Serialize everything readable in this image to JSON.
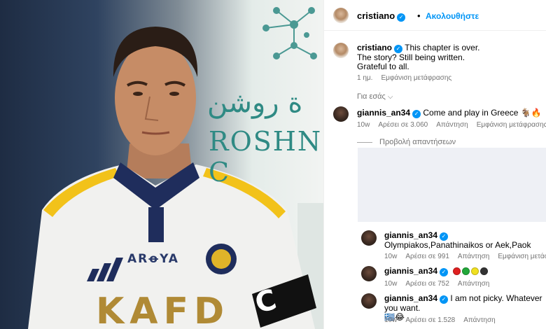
{
  "post": {
    "sign_arabic": "ة روشن",
    "sign_latin": "ROSHN C",
    "jersey_brand": "ARꝋYA",
    "jersey_sponsor": "KAFD",
    "armband_text": "C"
  },
  "header": {
    "username": "cristiano",
    "separator": "•",
    "follow_label": "Ακολουθήστε"
  },
  "caption": {
    "username": "cristiano",
    "line1": "This chapter is over.",
    "line2": "The story? Still being written.",
    "line3": "Grateful to all.",
    "time": "1 ημ.",
    "translate": "Εμφάνιση μετάφρασης"
  },
  "for_you": {
    "label": "Για εσάς",
    "icon": "chevron-down-icon"
  },
  "comments": [
    {
      "username": "giannis_an34",
      "text": "Come and play in Greece 🐐🔥",
      "time": "10w",
      "likes": "Αρέσει σε 3.060",
      "reply": "Απάντηση",
      "translate": "Εμφάνιση μετάφρασης"
    }
  ],
  "replies_toggle": "Προβολή απαντήσεων",
  "replies": [
    {
      "username": "giannis_an34",
      "text": "Olympiakos,Panathinaikos or Aek,Paok",
      "time": "10w",
      "likes": "Αρέσει σε 991",
      "reply": "Απάντηση",
      "translate": "Εμφάνιση μετάφρασης"
    },
    {
      "username": "giannis_an34",
      "circles": [
        "#e02020",
        "#22a83a",
        "#f0e020",
        "#333333"
      ],
      "time": "10w",
      "likes": "Αρέσει σε 752",
      "reply": "Απάντηση"
    },
    {
      "username": "giannis_an34",
      "text": "I am not picky. Whatever you want.",
      "text2": "🇬🇷😂",
      "time": "10w",
      "likes": "Αρέσει σε 1.528",
      "reply": "Απάντηση"
    }
  ],
  "colors": {
    "accent": "#0095f6",
    "muted": "#737373",
    "sign_teal": "#2f8a84"
  }
}
